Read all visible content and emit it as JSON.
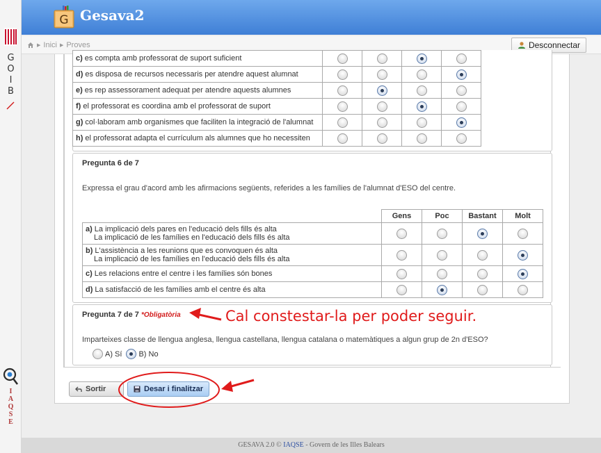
{
  "app": {
    "title": "Gesava2",
    "logo_letter": "G"
  },
  "side": {
    "brand_top": [
      "G",
      "O",
      "I",
      "B"
    ],
    "brand_bottom": [
      "I",
      "A",
      "Q",
      "S",
      "E"
    ]
  },
  "breadcrumb": {
    "items": [
      "Inici",
      "Proves"
    ]
  },
  "header": {
    "logout_label": "Desconnectar"
  },
  "q5": {
    "rows": [
      {
        "letter": "c)",
        "text": "es compta amb professorat de suport suficient",
        "selected": 2
      },
      {
        "letter": "d)",
        "text": "es disposa de recursos necessaris per atendre aquest alumnat",
        "selected": 3
      },
      {
        "letter": "e)",
        "text": "es rep assessorament adequat per atendre aquests alumnes",
        "selected": 1
      },
      {
        "letter": "f)",
        "text": "el professorat es coordina amb el professorat de suport",
        "selected": 2
      },
      {
        "letter": "g)",
        "text": "col·laboram amb organismes que faciliten la integració de l'alumnat",
        "selected": 3
      },
      {
        "letter": "h)",
        "text": "el professorat adapta el currículum als alumnes que ho necessiten",
        "selected": -1
      }
    ]
  },
  "q6": {
    "title": "Pregunta 6 de 7",
    "statement": "Expressa el grau d'acord amb les afirmacions següents, referides a les famílies de l'alumnat d'ESO del centre.",
    "columns": [
      "Gens",
      "Poc",
      "Bastant",
      "Molt"
    ],
    "rows": [
      {
        "letter": "a)",
        "text": "La implicació dels pares en l'educació dels fills és alta",
        "text2": "La implicació de les famílies en l'educació dels fills és alta",
        "selected": 2
      },
      {
        "letter": "b)",
        "text": "L'assistència a les reunions que es convoquen és alta",
        "text2": "La implicació de les famílies en l'educació dels fills és alta",
        "selected": 3
      },
      {
        "letter": "c)",
        "text": "Les relacions entre el centre i les famílies són bones",
        "text2": "",
        "selected": 3
      },
      {
        "letter": "d)",
        "text": "La satisfacció de les famílies amb el centre és alta",
        "text2": "",
        "selected": 1
      }
    ]
  },
  "q7": {
    "title": "Pregunta 7 de 7",
    "required": "*Obligatòria",
    "statement": "Imparteixes classe de llengua anglesa, llengua castellana, llengua catalana o matemàtiques a algun grup de 2n d'ESO?",
    "options": [
      {
        "label": "A) Sí",
        "selected": false
      },
      {
        "label": "B) No",
        "selected": true
      }
    ]
  },
  "actions": {
    "back_label": "Sortir",
    "save_label": "Desar i finalitzar"
  },
  "annotation": {
    "text": "Cal constestar-la per poder seguir.",
    "color": "#e01b1b"
  },
  "footer": {
    "prefix": "GESAVA 2.0 © ",
    "link": "IAQSE",
    "suffix": " - Govern de les Illes Balears"
  },
  "colors": {
    "header": "#4a8ae0",
    "accent_red": "#e01b1b"
  }
}
